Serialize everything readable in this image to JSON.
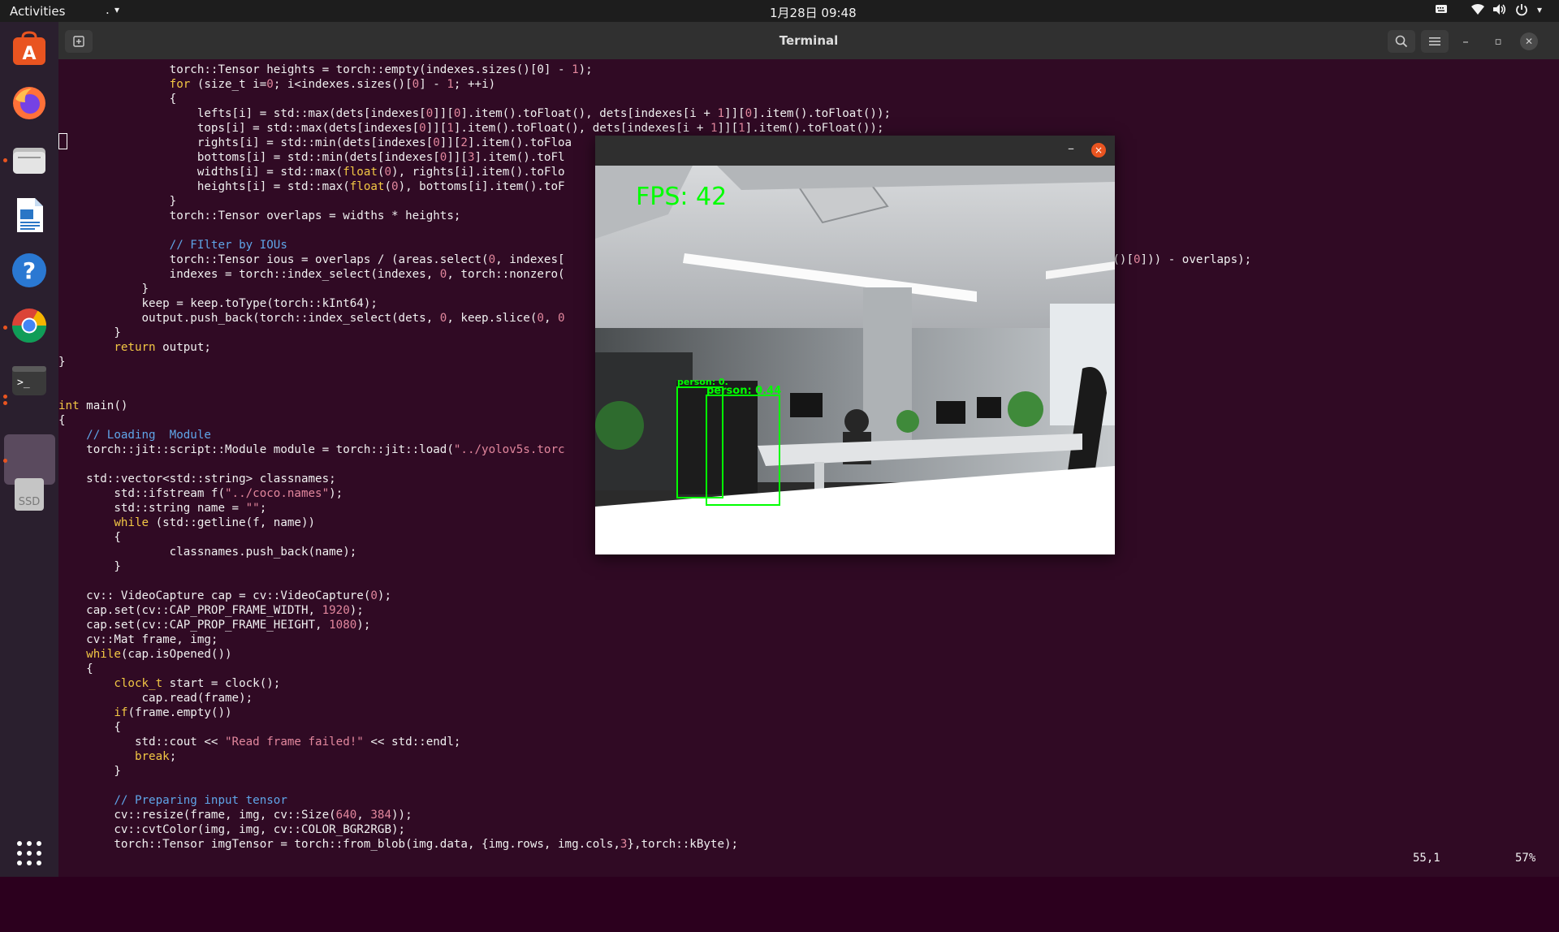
{
  "topbar": {
    "activities": "Activities",
    "app_menu": ".",
    "app_menu_arrow": "▾",
    "clock": "1月28日 09:48",
    "tray": {
      "keyboard_icon": "keyboard-icon",
      "wifi_icon": "wifi-icon",
      "volume_icon": "volume-icon",
      "power_icon": "power-icon",
      "menu_arrow": "▾"
    }
  },
  "dock": {
    "items": [
      {
        "name": "ubuntu-software",
        "icon": "software-store-icon",
        "color": "#e95420",
        "running": false
      },
      {
        "name": "firefox",
        "icon": "firefox-icon",
        "color": "#ff7139",
        "running": false
      },
      {
        "name": "files",
        "icon": "files-icon",
        "color": "#c9c9c9",
        "running": true
      },
      {
        "name": "libreoffice-writer",
        "icon": "writer-icon",
        "color": "#2a76c6",
        "running": false
      },
      {
        "name": "help",
        "icon": "help-icon",
        "color": "#2a78d2",
        "running": false
      },
      {
        "name": "chrome",
        "icon": "chrome-icon",
        "color": "#4285f4",
        "running": true
      },
      {
        "name": "terminal",
        "icon": "terminal-icon",
        "color": "#3a3a3a",
        "running": true
      },
      {
        "name": "opencv-window",
        "icon": "window-icon",
        "color": "#5a4a5e",
        "running": true
      },
      {
        "name": "ssd",
        "icon": "drive-icon",
        "color": "#c5c5c5",
        "running": false,
        "label": "SSD"
      }
    ],
    "show_apps_icon": "grid-icon"
  },
  "terminal": {
    "title": "Terminal",
    "new_tab_icon": "new-tab-icon",
    "search_icon": "search-icon",
    "menu_icon": "hamburger-icon",
    "minimize": "–",
    "maximize": "▫",
    "close": "✕",
    "status_position": "55,1",
    "status_percent": "57%",
    "colors": {
      "background": "#300a24",
      "text": "#f0f0f0",
      "keyword": "#f2c744",
      "comment": "#5fa5e8",
      "string": "#e2879d"
    },
    "lines": [
      [
        {
          "t": "                torch::Tensor heights = torch::empty(indexes.sizes()[0] - ",
          "c": ""
        },
        {
          "t": "1",
          "c": "nm"
        },
        {
          "t": ");",
          "c": ""
        }
      ],
      [
        {
          "t": "                ",
          "c": ""
        },
        {
          "t": "for",
          "c": "kw"
        },
        {
          "t": " (size_t i=",
          "c": ""
        },
        {
          "t": "0",
          "c": "nm"
        },
        {
          "t": "; i<indexes.sizes()[",
          "c": ""
        },
        {
          "t": "0",
          "c": "nm"
        },
        {
          "t": "] - ",
          "c": ""
        },
        {
          "t": "1",
          "c": "nm"
        },
        {
          "t": "; ++i)",
          "c": ""
        }
      ],
      [
        {
          "t": "                {",
          "c": ""
        }
      ],
      [
        {
          "t": "                    lefts[i] = std::max(dets[indexes[",
          "c": ""
        },
        {
          "t": "0",
          "c": "nm"
        },
        {
          "t": "]][",
          "c": ""
        },
        {
          "t": "0",
          "c": "nm"
        },
        {
          "t": "].item().toFloat(), dets[indexes[i + ",
          "c": ""
        },
        {
          "t": "1",
          "c": "nm"
        },
        {
          "t": "]][",
          "c": ""
        },
        {
          "t": "0",
          "c": "nm"
        },
        {
          "t": "].item().toFloat());",
          "c": ""
        }
      ],
      [
        {
          "t": "                    tops[i] = std::max(dets[indexes[",
          "c": ""
        },
        {
          "t": "0",
          "c": "nm"
        },
        {
          "t": "]][",
          "c": ""
        },
        {
          "t": "1",
          "c": "nm"
        },
        {
          "t": "].item().toFloat(), dets[indexes[i + ",
          "c": ""
        },
        {
          "t": "1",
          "c": "nm"
        },
        {
          "t": "]][",
          "c": ""
        },
        {
          "t": "1",
          "c": "nm"
        },
        {
          "t": "].item().toFloat());",
          "c": ""
        }
      ],
      [
        {
          "t": "                    rights[i] = std::min(dets[indexes[",
          "c": ""
        },
        {
          "t": "0",
          "c": "nm"
        },
        {
          "t": "]][",
          "c": ""
        },
        {
          "t": "2",
          "c": "nm"
        },
        {
          "t": "].item().toFloa",
          "c": ""
        }
      ],
      [
        {
          "t": "                    bottoms[i] = std::min(dets[indexes[",
          "c": ""
        },
        {
          "t": "0",
          "c": "nm"
        },
        {
          "t": "]][",
          "c": ""
        },
        {
          "t": "3",
          "c": "nm"
        },
        {
          "t": "].item().toFl",
          "c": ""
        }
      ],
      [
        {
          "t": "                    widths[i] = std::max(",
          "c": ""
        },
        {
          "t": "float",
          "c": "kw"
        },
        {
          "t": "(",
          "c": ""
        },
        {
          "t": "0",
          "c": "nm"
        },
        {
          "t": "), rights[i].item().toFlo",
          "c": ""
        }
      ],
      [
        {
          "t": "                    heights[i] = std::max(",
          "c": ""
        },
        {
          "t": "float",
          "c": "kw"
        },
        {
          "t": "(",
          "c": ""
        },
        {
          "t": "0",
          "c": "nm"
        },
        {
          "t": "), bottoms[i].item().toF",
          "c": ""
        }
      ],
      [
        {
          "t": "                }",
          "c": ""
        }
      ],
      [
        {
          "t": "                torch::Tensor overlaps = widths * heights;",
          "c": ""
        }
      ],
      [
        {
          "t": "",
          "c": ""
        }
      ],
      [
        {
          "t": "                ",
          "c": ""
        },
        {
          "t": "// FIlter by IOUs",
          "c": "cm"
        }
      ],
      [
        {
          "t": "                torch::Tensor ious = overlaps / (areas.select(",
          "c": ""
        },
        {
          "t": "0",
          "c": "nm"
        },
        {
          "t": ", indexes[",
          "c": ""
        },
        {
          "t": "                                                                   ",
          "c": ""
        },
        {
          "t": "ndexes.sizes()[",
          "c": ""
        },
        {
          "t": "0",
          "c": "nm"
        },
        {
          "t": "])) - overlaps);",
          "c": ""
        }
      ],
      [
        {
          "t": "                indexes = torch::index_select(indexes, ",
          "c": ""
        },
        {
          "t": "0",
          "c": "nm"
        },
        {
          "t": ", torch::nonzero(",
          "c": ""
        }
      ],
      [
        {
          "t": "            }",
          "c": ""
        }
      ],
      [
        {
          "t": "            keep = keep.toType(torch::kInt64);",
          "c": ""
        }
      ],
      [
        {
          "t": "            output.push_back(torch::index_select(dets, ",
          "c": ""
        },
        {
          "t": "0",
          "c": "nm"
        },
        {
          "t": ", keep.slice(",
          "c": ""
        },
        {
          "t": "0",
          "c": "nm"
        },
        {
          "t": ", ",
          "c": ""
        },
        {
          "t": "0",
          "c": "nm"
        }
      ],
      [
        {
          "t": "        }",
          "c": ""
        }
      ],
      [
        {
          "t": "        ",
          "c": ""
        },
        {
          "t": "return",
          "c": "kw"
        },
        {
          "t": " output;",
          "c": ""
        }
      ],
      [
        {
          "t": "}",
          "c": ""
        }
      ],
      [
        {
          "t": "",
          "c": ""
        }
      ],
      [
        {
          "t": "",
          "c": ""
        }
      ],
      [
        {
          "t": "int",
          "c": "kw"
        },
        {
          "t": " main()",
          "c": ""
        }
      ],
      [
        {
          "t": "{",
          "c": ""
        }
      ],
      [
        {
          "t": "    ",
          "c": ""
        },
        {
          "t": "// Loading  Module",
          "c": "cm"
        }
      ],
      [
        {
          "t": "    torch::jit::script::Module module = torch::jit::load(",
          "c": ""
        },
        {
          "t": "\"../yolov5s.torc",
          "c": "st"
        }
      ],
      [
        {
          "t": "",
          "c": ""
        }
      ],
      [
        {
          "t": "    std::vector<std::string> classnames;",
          "c": ""
        }
      ],
      [
        {
          "t": "        std::ifstream f(",
          "c": ""
        },
        {
          "t": "\"../coco.names\"",
          "c": "st"
        },
        {
          "t": ");",
          "c": ""
        }
      ],
      [
        {
          "t": "        std::string name = ",
          "c": ""
        },
        {
          "t": "\"\"",
          "c": "st"
        },
        {
          "t": ";",
          "c": ""
        }
      ],
      [
        {
          "t": "        ",
          "c": ""
        },
        {
          "t": "while",
          "c": "kw"
        },
        {
          "t": " (std::getline(f, name))",
          "c": ""
        }
      ],
      [
        {
          "t": "        {",
          "c": ""
        }
      ],
      [
        {
          "t": "                classnames.push_back(name);",
          "c": ""
        }
      ],
      [
        {
          "t": "        }",
          "c": ""
        }
      ],
      [
        {
          "t": "",
          "c": ""
        }
      ],
      [
        {
          "t": "    cv:: VideoCapture cap = cv::VideoCapture(",
          "c": ""
        },
        {
          "t": "0",
          "c": "nm"
        },
        {
          "t": ");",
          "c": ""
        }
      ],
      [
        {
          "t": "    cap.set(cv::CAP_PROP_FRAME_WIDTH, ",
          "c": ""
        },
        {
          "t": "1920",
          "c": "nm"
        },
        {
          "t": ");",
          "c": ""
        }
      ],
      [
        {
          "t": "    cap.set(cv::CAP_PROP_FRAME_HEIGHT, ",
          "c": ""
        },
        {
          "t": "1080",
          "c": "nm"
        },
        {
          "t": ");",
          "c": ""
        }
      ],
      [
        {
          "t": "    cv::Mat frame, img;",
          "c": ""
        }
      ],
      [
        {
          "t": "    ",
          "c": ""
        },
        {
          "t": "while",
          "c": "kw"
        },
        {
          "t": "(cap.isOpened())",
          "c": ""
        }
      ],
      [
        {
          "t": "    {",
          "c": ""
        }
      ],
      [
        {
          "t": "        ",
          "c": ""
        },
        {
          "t": "clock_t",
          "c": "kw"
        },
        {
          "t": " start = clock();",
          "c": ""
        }
      ],
      [
        {
          "t": "            cap.read(frame);",
          "c": ""
        }
      ],
      [
        {
          "t": "        ",
          "c": ""
        },
        {
          "t": "if",
          "c": "kw"
        },
        {
          "t": "(frame.empty())",
          "c": ""
        }
      ],
      [
        {
          "t": "        {",
          "c": ""
        }
      ],
      [
        {
          "t": "           std::cout << ",
          "c": ""
        },
        {
          "t": "\"Read frame failed!\"",
          "c": "st"
        },
        {
          "t": " << std::endl;",
          "c": ""
        }
      ],
      [
        {
          "t": "           ",
          "c": ""
        },
        {
          "t": "break",
          "c": "kw"
        },
        {
          "t": ";",
          "c": ""
        }
      ],
      [
        {
          "t": "        }",
          "c": ""
        }
      ],
      [
        {
          "t": "",
          "c": ""
        }
      ],
      [
        {
          "t": "        ",
          "c": ""
        },
        {
          "t": "// Preparing input tensor",
          "c": "cm"
        }
      ],
      [
        {
          "t": "        cv::resize(frame, img, cv::Size(",
          "c": ""
        },
        {
          "t": "640",
          "c": "nm"
        },
        {
          "t": ", ",
          "c": ""
        },
        {
          "t": "384",
          "c": "nm"
        },
        {
          "t": "));",
          "c": ""
        }
      ],
      [
        {
          "t": "        cv::cvtColor(img, img, cv::COLOR_BGR2RGB);",
          "c": ""
        }
      ],
      [
        {
          "t": "        torch::Tensor imgTensor = torch::from_blob(img.data, {img.rows, img.cols,",
          "c": ""
        },
        {
          "t": "3",
          "c": "nm"
        },
        {
          "t": "},torch::kByte);",
          "c": ""
        }
      ]
    ]
  },
  "camera_window": {
    "minimize": "–",
    "close": "×",
    "fps_label": "FPS: 42",
    "fps_color": "#00ff00",
    "detections": [
      {
        "label": "person: 0.",
        "color": "#00ff00"
      },
      {
        "label": "person: 0.44",
        "color": "#00ff00"
      }
    ]
  }
}
